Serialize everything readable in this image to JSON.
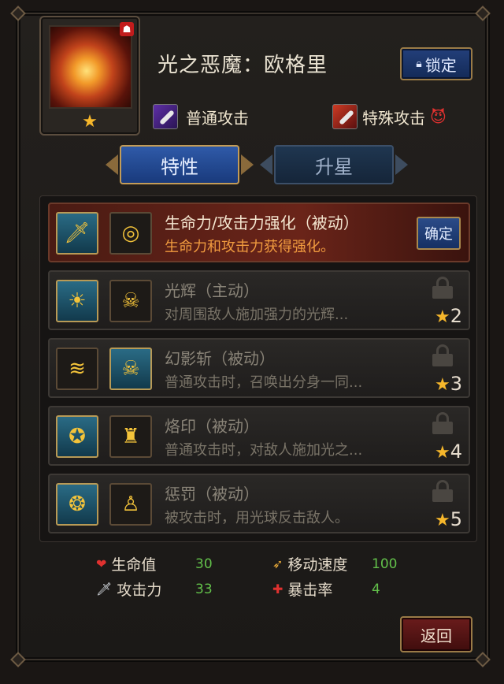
{
  "hero": {
    "name": "光之恶魔：欧格里",
    "star_glyph": "★",
    "badge_glyph": "☗"
  },
  "header": {
    "lock_label": "锁定"
  },
  "attacks": {
    "normal_label": "普通攻击",
    "special_label": "特殊攻击"
  },
  "tabs": [
    {
      "label": "特性"
    },
    {
      "label": "升星"
    }
  ],
  "skills": [
    {
      "title": "生命力/攻击力强化（被动）",
      "desc": "生命力和攻击力获得强化。",
      "confirm_label": "确定"
    },
    {
      "title": "光辉（主动）",
      "desc": "对周围敌人施加强力的光辉...",
      "stars": "2"
    },
    {
      "title": "幻影斩（被动）",
      "desc": "普通攻击时，召唤出分身一同...",
      "stars": "3"
    },
    {
      "title": "烙印（被动）",
      "desc": "普通攻击时，对敌人施加光之...",
      "stars": "4"
    },
    {
      "title": "惩罚（被动）",
      "desc": "被攻击时，用光球反击敌人。",
      "stars": "5"
    }
  ],
  "stats": {
    "hp": {
      "label": "生命值",
      "value": "30"
    },
    "atk": {
      "label": "攻击力",
      "value": "33"
    },
    "move": {
      "label": "移动速度",
      "value": "100"
    },
    "crit": {
      "label": "暴击率",
      "value": "4"
    }
  },
  "footer": {
    "return_label": "返回"
  },
  "colors": {
    "accent_gold": "#c39c57",
    "active_blue": "#2f5aa8",
    "active_skill_desc": "#f09b3f",
    "stat_value_green": "#62c04a"
  }
}
